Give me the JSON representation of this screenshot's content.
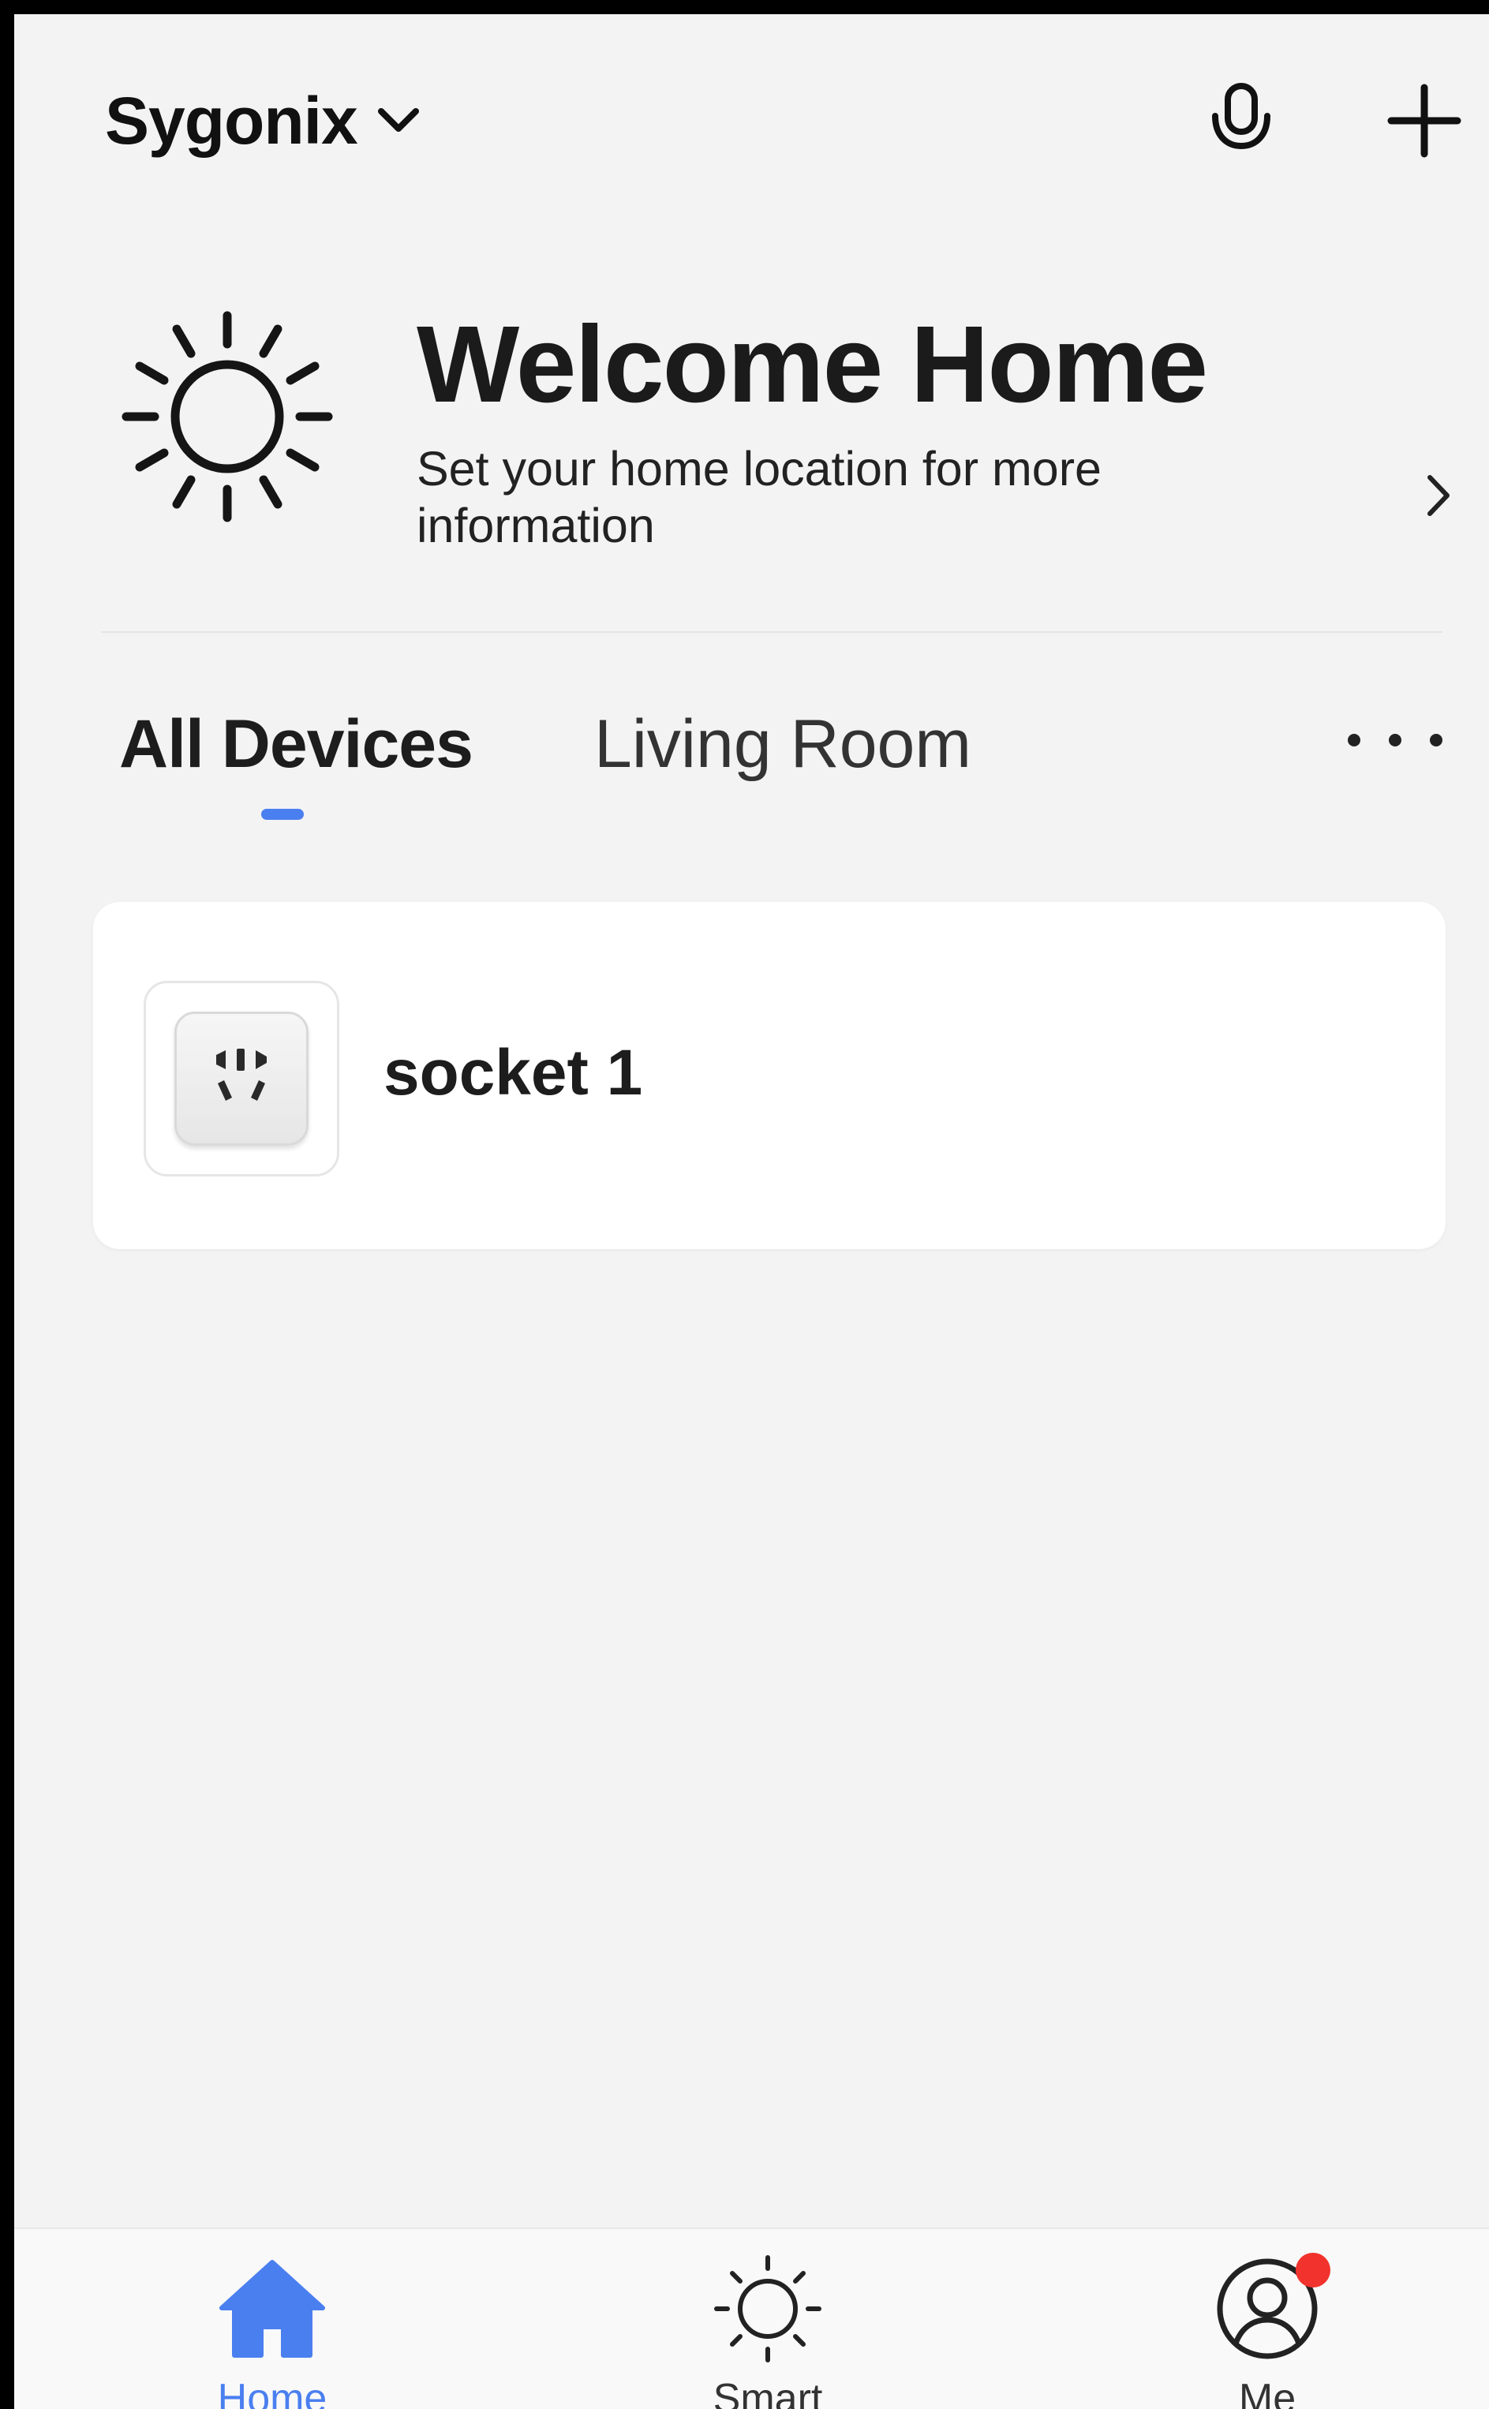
{
  "header": {
    "home_name": "Sygonix",
    "dropdown_icon": "chevron-down-icon",
    "mic_icon": "microphone-icon",
    "add_icon": "plus-icon"
  },
  "welcome": {
    "icon": "sun-icon",
    "title": "Welcome Home",
    "subtitle": "Set your home location for more information",
    "arrow_icon": "chevron-right-icon"
  },
  "tabs": {
    "items": [
      {
        "label": "All Devices",
        "selected": true
      },
      {
        "label": "Living Room",
        "selected": false
      }
    ],
    "more_icon": "more-dots-icon",
    "accent_color": "#4a7ff0"
  },
  "devices": [
    {
      "name": "socket 1",
      "icon": "socket-icon"
    }
  ],
  "bottom_nav": {
    "items": [
      {
        "label": "Home",
        "icon": "home-icon",
        "active": true
      },
      {
        "label": "Smart",
        "icon": "sun-icon",
        "active": false
      },
      {
        "label": "Me",
        "icon": "user-icon",
        "active": false,
        "has_notification": true
      }
    ],
    "active_color": "#4a7ff0",
    "badge_color": "#f2322c"
  }
}
